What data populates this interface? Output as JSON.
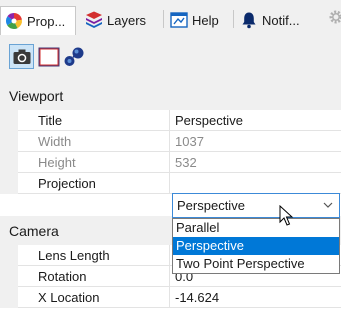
{
  "tabs": [
    {
      "label": "Prop...",
      "icon": "color-wheel-icon"
    },
    {
      "label": "Layers",
      "icon": "layers-icon"
    },
    {
      "label": "Help",
      "icon": "help-icon"
    },
    {
      "label": "Notif...",
      "icon": "bell-icon"
    }
  ],
  "toolbar": {
    "buttons": [
      "camera-icon",
      "rectangle-frame-icon",
      "material-spheres-icon"
    ]
  },
  "sections": {
    "viewport": "Viewport",
    "camera": "Camera"
  },
  "viewport_rows": [
    {
      "name": "Title",
      "value": "Perspective",
      "disabled": false
    },
    {
      "name": "Width",
      "value": "1037",
      "disabled": true
    },
    {
      "name": "Height",
      "value": "532",
      "disabled": true
    },
    {
      "name": "Projection",
      "value": "Perspective",
      "disabled": false
    }
  ],
  "camera_rows": [
    {
      "name": "Lens Length",
      "value": "",
      "disabled": false
    },
    {
      "name": "Rotation",
      "value": "0.0",
      "disabled": false
    },
    {
      "name": "X Location",
      "value": "-14.624",
      "disabled": false
    }
  ],
  "projection_options": [
    "Parallel",
    "Perspective",
    "Two Point Perspective"
  ],
  "projection_highlighted": "Perspective",
  "colors": {
    "selection": "#0078d7",
    "combo_border": "#3c8ad8"
  }
}
